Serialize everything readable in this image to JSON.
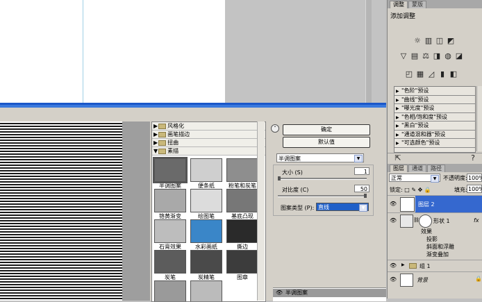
{
  "adjustments_panel": {
    "tabs": [
      "调整",
      "蒙版"
    ],
    "active_tab": "调整",
    "title": "添加调整",
    "presets": [
      "\"色阶\"预设",
      "\"曲线\"预设",
      "\"曝光度\"预设",
      "\"色相/饱和度\"预设",
      "\"黑白\"预设",
      "\"通道混和器\"预设",
      "\"可选颜色\"预设"
    ]
  },
  "layers_panel": {
    "tabs": [
      "图层",
      "通道",
      "路径"
    ],
    "active_tab": "图层",
    "blend_mode": "正常",
    "opacity_label": "不透明度:",
    "opacity_value": "100%",
    "lock_label": "锁定:",
    "fill_label": "填充:",
    "fill_value": "100%",
    "layers": {
      "layer2": "图层 2",
      "shape1": "形状 1",
      "effects": "效果",
      "effect_items": [
        "投影",
        "斜面和浮雕",
        "渐变叠加"
      ],
      "group1": "组 1",
      "background": "背景",
      "fx": "fx"
    }
  },
  "filter_gallery": {
    "categories": [
      "风格化",
      "画笔描边",
      "扭曲",
      "素描"
    ],
    "thumbnails": [
      "半调图案",
      "便条纸",
      "粉笔和炭笔",
      "铬黄渐变",
      "绘图笔",
      "基底凸现",
      "石膏效果",
      "水彩画纸",
      "撕边",
      "炭笔",
      "炭精笔",
      "图章"
    ],
    "ok_button": "确定",
    "default_button": "默认值",
    "selected_filter": "半调图案",
    "size_label": "大小 (S)",
    "size_value": "1",
    "contrast_label": "对比度 (C)",
    "contrast_value": "50",
    "pattern_type_label": "图案类型 (P):",
    "pattern_type_value": "直线",
    "effect_layer": "半调图案",
    "size_fraction": 0.0,
    "contrast_fraction": 1.0
  },
  "colors": {
    "selection_blue": "#3568cf",
    "title_blue": "#1b57c9"
  }
}
